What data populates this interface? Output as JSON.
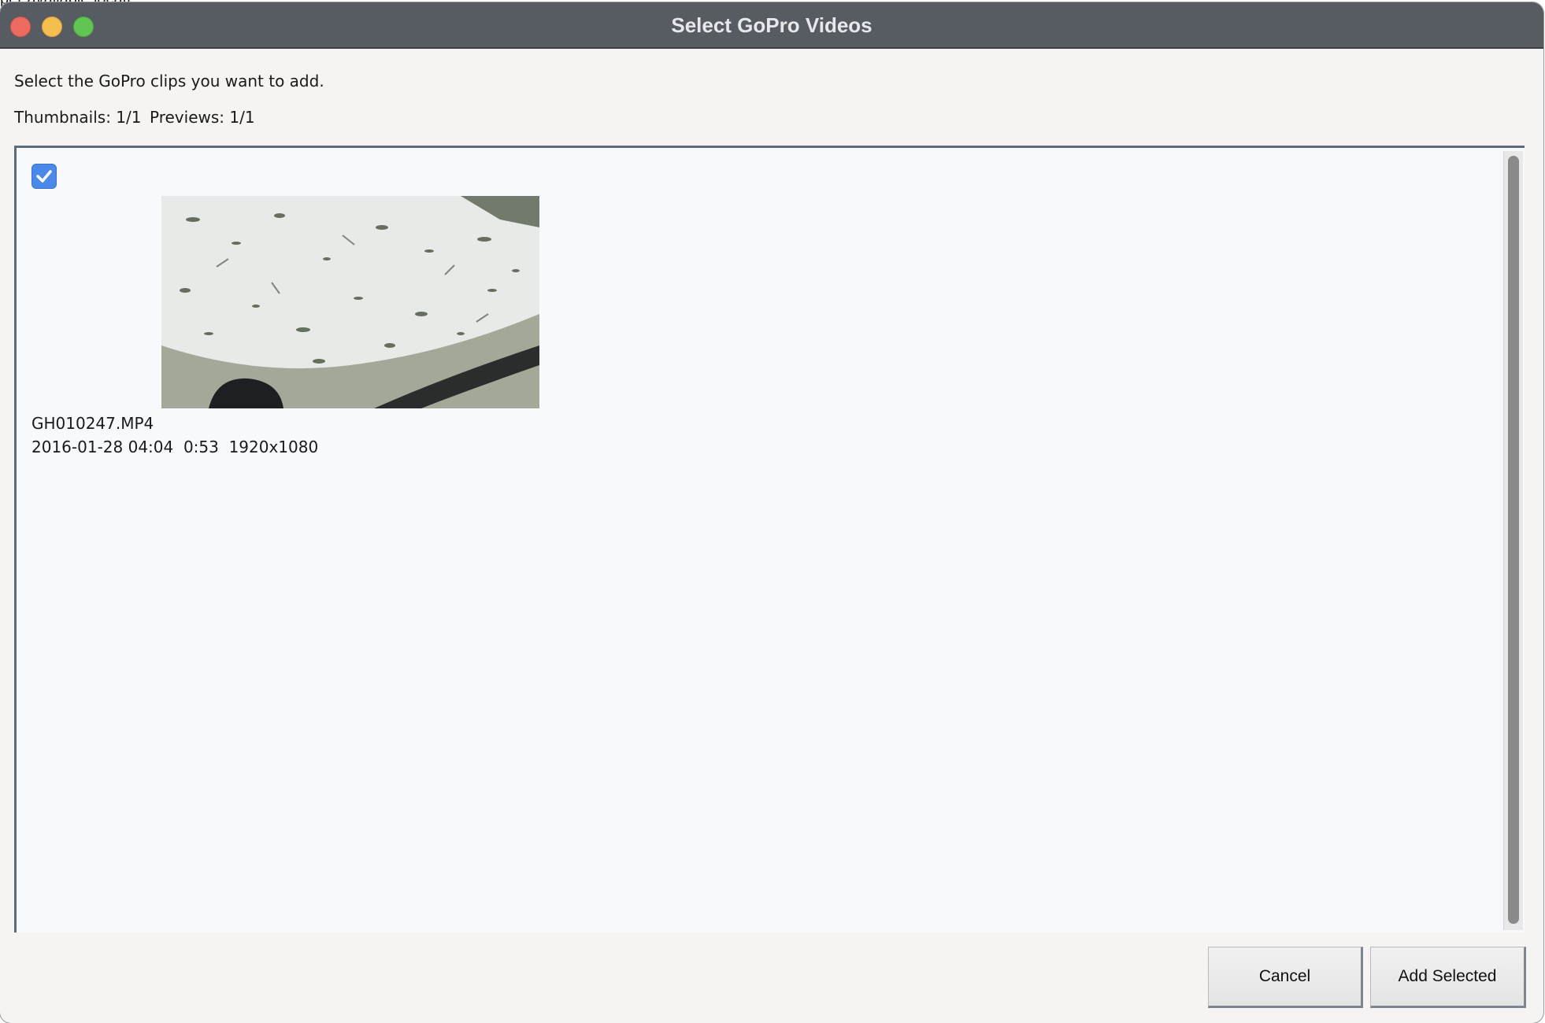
{
  "background": {
    "text": "per available locati"
  },
  "window": {
    "title": "Select GoPro Videos"
  },
  "dialog": {
    "instruction": "Select the GoPro clips you want to add.",
    "thumbnails_label": "Thumbnails: 1/1",
    "previews_label": "Previews: 1/1"
  },
  "clips": [
    {
      "checked": true,
      "filename": "GH010247.MP4",
      "meta": "2016-01-28 04:04  0:53  1920x1080"
    }
  ],
  "buttons": {
    "cancel": "Cancel",
    "add_selected": "Add Selected"
  },
  "colors": {
    "titlebar": "#575c63",
    "checkbox": "#4a89e8",
    "close": "#ed6a5e",
    "minimize": "#f4bf4f",
    "maximize": "#61c554"
  }
}
